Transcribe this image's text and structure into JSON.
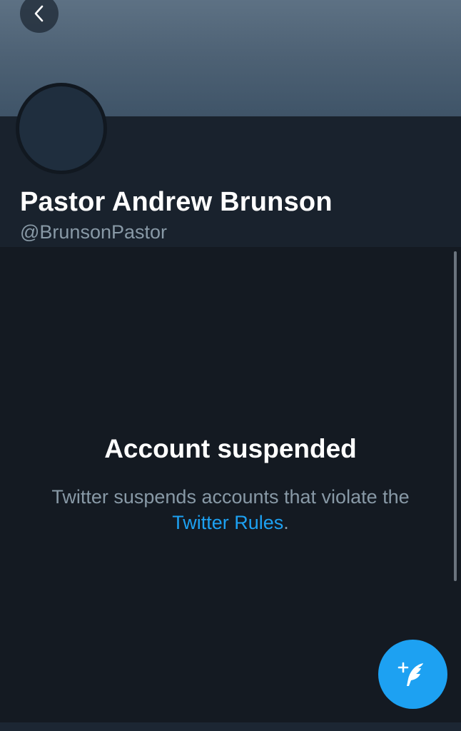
{
  "profile": {
    "display_name": "Pastor Andrew Brunson",
    "handle": "@BrunsonPastor"
  },
  "suspension": {
    "title": "Account suspended",
    "message_part1": "Twitter suspends accounts that violate the ",
    "link_text": "Twitter Rules",
    "message_part2": "."
  },
  "icons": {
    "back": "chevron-left-icon",
    "compose": "compose-quill-icon"
  },
  "colors": {
    "accent": "#1da1f2",
    "background": "#141a22",
    "header_background": "#19222d",
    "secondary_text": "#8899a6"
  }
}
